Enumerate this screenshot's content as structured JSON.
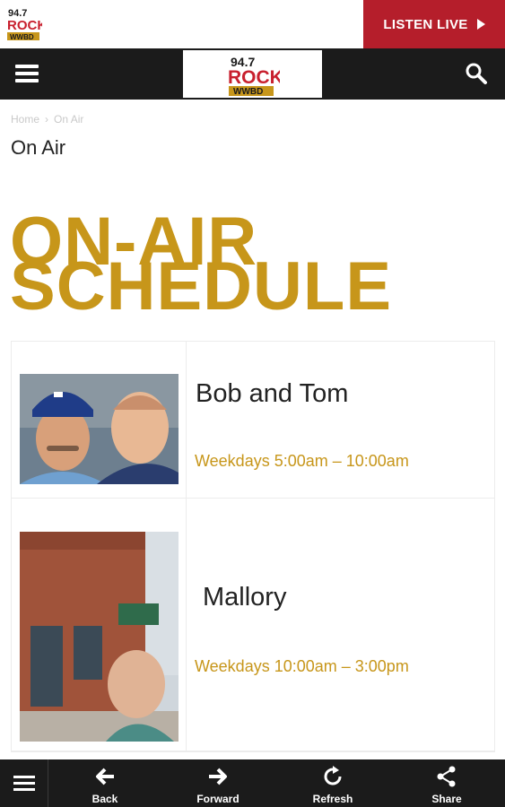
{
  "header": {
    "logo_alt": "94.7 ROCK WWBD",
    "logo_line1": "94.7",
    "logo_line2": "ROCK",
    "logo_line3": "WWBD",
    "listen_live_label": "LISTEN LIVE",
    "brand_color": "#b51e2b"
  },
  "breadcrumb": {
    "home": "Home",
    "separator": "›",
    "current": "On Air"
  },
  "page": {
    "title": "On Air",
    "heading_line1": "ON-AIR",
    "heading_line2": "SCHEDULE",
    "accent_color": "#c7961a"
  },
  "schedule": [
    {
      "name": "Bob and Tom",
      "time": "Weekdays 5:00am – 10:00am"
    },
    {
      "name": "Mallory",
      "time": "Weekdays 10:00am – 3:00pm"
    }
  ],
  "toolbar": {
    "back": "Back",
    "forward": "Forward",
    "refresh": "Refresh",
    "share": "Share"
  },
  "icons": [
    "menu-icon",
    "search-icon",
    "play-icon",
    "back-arrow-icon",
    "forward-arrow-icon",
    "refresh-icon",
    "share-icon"
  ]
}
